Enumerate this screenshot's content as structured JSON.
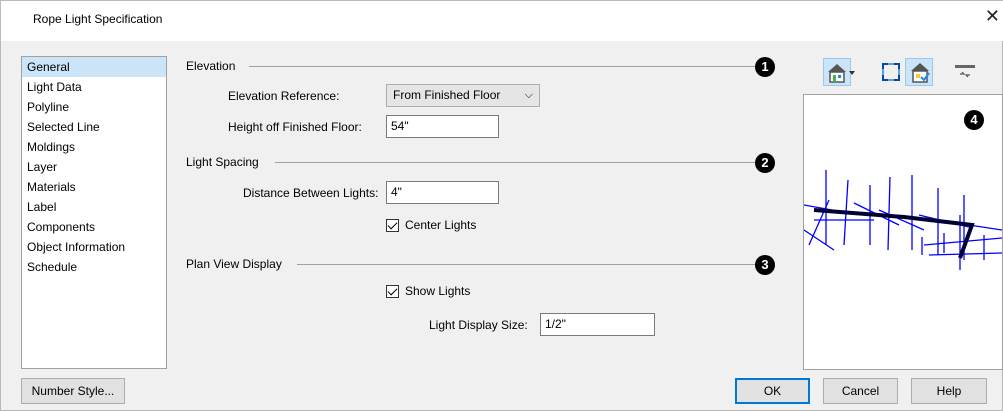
{
  "window": {
    "title": "Rope Light Specification",
    "close_icon": "close-icon"
  },
  "nav": {
    "items": [
      "General",
      "Light Data",
      "Polyline",
      "Selected Line",
      "Moldings",
      "Layer",
      "Materials",
      "Label",
      "Components",
      "Object Information",
      "Schedule"
    ],
    "selected": "General"
  },
  "elevation": {
    "title": "Elevation",
    "callout": "1",
    "reference_label": "Elevation Reference:",
    "reference_value": "From Finished Floor",
    "height_label": "Height off Finished Floor:",
    "height_value": "54\""
  },
  "spacing": {
    "title": "Light Spacing",
    "callout": "2",
    "distance_label": "Distance Between Lights:",
    "distance_value": "4\"",
    "center_label": "Center Lights",
    "center_checked": true
  },
  "plan": {
    "title": "Plan View Display",
    "callout": "3",
    "show_label": "Show Lights",
    "show_checked": true,
    "size_label": "Light Display Size:",
    "size_value": "1/2\""
  },
  "preview": {
    "callout": "4",
    "tools": [
      "house-view-icon",
      "fit-view-icon",
      "house-check-icon",
      "level-icon"
    ],
    "line_color": "#0000ff"
  },
  "buttons": {
    "number_style": "Number Style...",
    "ok": "OK",
    "cancel": "Cancel",
    "help": "Help"
  },
  "colors": {
    "accent": "#0078d7",
    "selection": "#cce4f7"
  }
}
